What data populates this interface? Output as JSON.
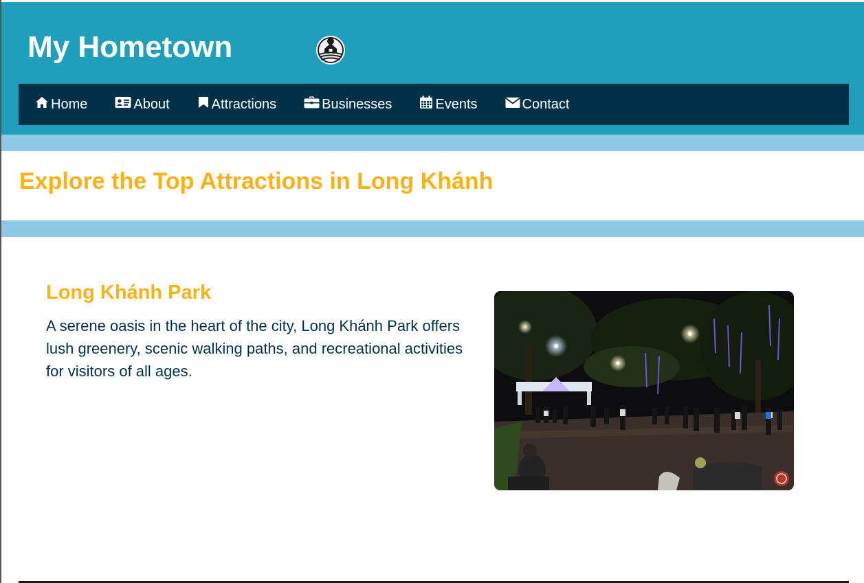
{
  "site": {
    "title": "My Hometown",
    "logo_icon": "house-field-logo-icon"
  },
  "nav": {
    "items": [
      {
        "label": "Home",
        "icon": "home-icon"
      },
      {
        "label": "About",
        "icon": "id-card-icon"
      },
      {
        "label": "Attractions",
        "icon": "bookmark-icon"
      },
      {
        "label": "Businesses",
        "icon": "briefcase-icon"
      },
      {
        "label": "Events",
        "icon": "calendar-icon"
      },
      {
        "label": "Contact",
        "icon": "envelope-icon"
      }
    ]
  },
  "main": {
    "heading": "Explore the Top Attractions in Long Khánh",
    "attraction": {
      "title": "Long Khánh Park",
      "description": "A serene oasis in the heart of the city, Long Khánh Park offers lush greenery, scenic walking paths, and recreational activities for visitors of all ages."
    }
  },
  "colors": {
    "header_bg": "#219ebc",
    "nav_bg": "#023047",
    "band": "#8ecae6",
    "accent": "#fbb117",
    "body_text": "#023047"
  }
}
